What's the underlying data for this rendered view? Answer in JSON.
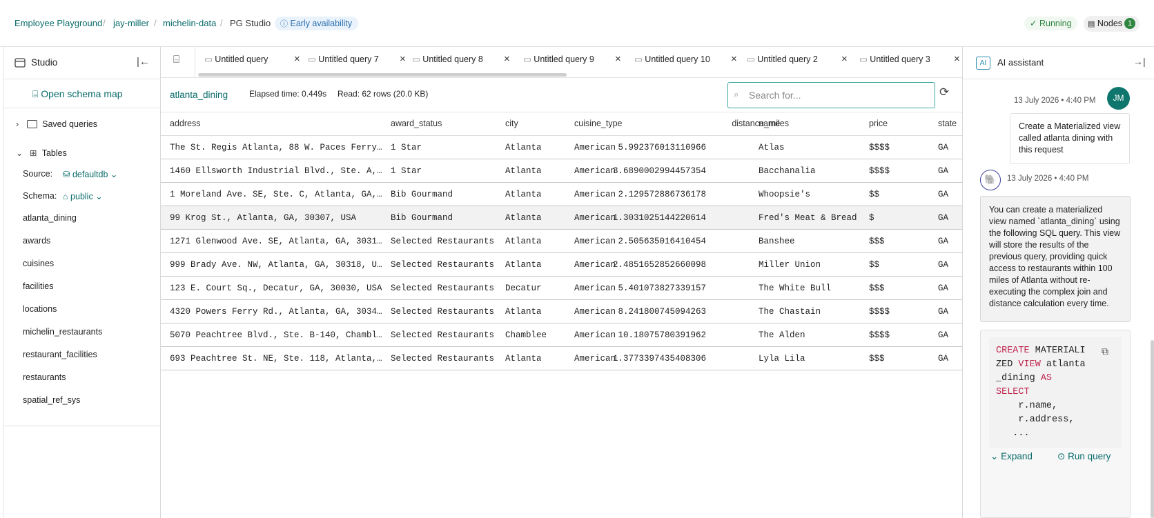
{
  "breadcrumb": [
    "Employee Playground",
    "jay-miller",
    "michelin-data",
    "PG Studio"
  ],
  "badge_early": "Early availability",
  "status_running": "Running",
  "nodes": {
    "label": "Nodes",
    "count": "1"
  },
  "sidebar": {
    "title": "Studio",
    "schema_map": "Open schema map",
    "saved_queries": "Saved queries",
    "tables_label": "Tables",
    "source_label": "Source:",
    "source_value": "defaultdb",
    "schema_label": "Schema:",
    "schema_value": "public",
    "tables": [
      "atlanta_dining",
      "awards",
      "cuisines",
      "facilities",
      "locations",
      "michelin_restaurants",
      "restaurant_facilities",
      "restaurants",
      "spatial_ref_sys"
    ]
  },
  "tabs": [
    "Untitled query",
    "Untitled query 7",
    "Untitled query 8",
    "Untitled query 9",
    "Untitled query 10",
    "Untitled query 2",
    "Untitled query 3"
  ],
  "results": {
    "table_name": "atlanta_dining",
    "elapsed": "Elapsed time: 0.449s",
    "read": "Read: 62 rows (20.0 KB)",
    "search_placeholder": "Search for...",
    "columns": [
      "address",
      "award_status",
      "city",
      "cuisine_type",
      "distance_miles",
      "name",
      "price",
      "state"
    ],
    "rows": [
      [
        "The St. Regis Atlanta, 88 W. Paces Ferry…",
        "1 Star",
        "Atlanta",
        "American",
        "5.992376013110966",
        "Atlas",
        "$$$$",
        "GA"
      ],
      [
        "1460 Ellsworth Industrial Blvd., Ste. A,…",
        "1 Star",
        "Atlanta",
        "American",
        "3.6890002994457354",
        "Bacchanalia",
        "$$$$",
        "GA"
      ],
      [
        "1 Moreland Ave. SE, Ste. C, Atlanta, GA,…",
        "Bib Gourmand",
        "Atlanta",
        "American",
        "2.129572886736178",
        "Whoopsie's",
        "$$",
        "GA"
      ],
      [
        "99 Krog St., Atlanta, GA, 30307, USA",
        "Bib Gourmand",
        "Atlanta",
        "American",
        "1.3031025144220614",
        "Fred's Meat & Bread",
        "$",
        "GA"
      ],
      [
        "1271 Glenwood Ave. SE, Atlanta, GA, 3031…",
        "Selected Restaurants",
        "Atlanta",
        "American",
        "2.505635016410454",
        "Banshee",
        "$$$",
        "GA"
      ],
      [
        "999 Brady Ave. NW, Atlanta, GA, 30318, U…",
        "Selected Restaurants",
        "Atlanta",
        "American",
        "2.4851652852660098",
        "Miller Union",
        "$$",
        "GA"
      ],
      [
        "123 E. Court Sq., Decatur, GA, 30030, USA",
        "Selected Restaurants",
        "Decatur",
        "American",
        "5.401073827339157",
        "The White Bull",
        "$$$",
        "GA"
      ],
      [
        "4320 Powers Ferry Rd., Atlanta, GA, 3034…",
        "Selected Restaurants",
        "Atlanta",
        "American",
        "8.241800745094263",
        "The Chastain",
        "$$$$",
        "GA"
      ],
      [
        "5070 Peachtree Blvd., Ste. B-140, Chambl…",
        "Selected Restaurants",
        "Chamblee",
        "American",
        "10.18075780391962",
        "The Alden",
        "$$$$",
        "GA"
      ],
      [
        "693 Peachtree St. NE, Ste. 118, Atlanta,…",
        "Selected Restaurants",
        "Atlanta",
        "American",
        "1.3773397435408306",
        "Lyla Lila",
        "$$$",
        "GA"
      ]
    ]
  },
  "assistant": {
    "title": "AI assistant",
    "user_initials": "JM",
    "user_time": "13 July 2026 • 4:40 PM",
    "user_message": "Create a Materialized view called atlanta dining with this request",
    "bot_time": "13 July 2026 • 4:40 PM",
    "bot_message": "You can create a materialized view named `atlanta_dining` using the following SQL query. This view will store the results of the previous query, providing quick access to restaurants within 100 miles of Atlanta without re-executing the complex join and distance calculation every time.",
    "sql_lines": [
      [
        [
          "kw",
          "CREATE"
        ],
        [
          "t",
          " MATERIALI"
        ]
      ],
      [
        [
          "t",
          "ZED "
        ],
        [
          "kw",
          "VIEW"
        ],
        [
          "t",
          " atlanta"
        ]
      ],
      [
        [
          "t",
          "_dining "
        ],
        [
          "kw",
          "AS"
        ]
      ],
      [
        [
          "kw",
          "SELECT"
        ]
      ],
      [
        [
          "t",
          "    r.name,"
        ]
      ],
      [
        [
          "t",
          "    r.address,"
        ]
      ],
      [
        [
          "t",
          "   ..."
        ]
      ]
    ],
    "expand": "Expand",
    "run_query": "Run query"
  }
}
